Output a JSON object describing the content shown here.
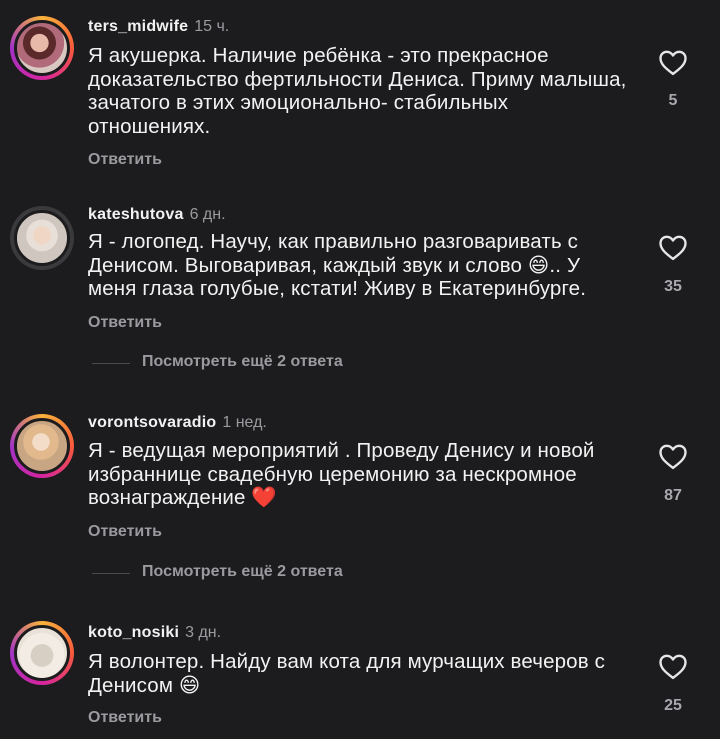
{
  "comments": [
    {
      "username": "ters_midwife",
      "time": "15 ч.",
      "text": "Я акушерка. Наличие ребёнка - это прекрасное доказательство фертильности Дениса.  Приму малыша, зачатого  в этих эмоционально- стабильных отношениях.",
      "reply_label": "Ответить",
      "likes": "5"
    },
    {
      "username": "kateshutova",
      "time": "6 дн.",
      "text": "Я - логопед. Научу, как правильно разговаривать с Денисом. Выговаривая, каждый звук и слово 😄.. У меня глаза голубые, кстати! Живу в Екатеринбурге.",
      "reply_label": "Ответить",
      "likes": "35",
      "more_replies": "Посмотреть ещё 2 ответа"
    },
    {
      "username": "vorontsovaradio",
      "time": "1 нед.",
      "text": "Я - ведущая мероприятий . Проведу Денису и новой избраннице свадебную церемонию за нескромное вознаграждение ❤️",
      "reply_label": "Ответить",
      "likes": "87",
      "more_replies": "Посмотреть ещё 2 ответа"
    },
    {
      "username": "koto_nosiki",
      "time": "3 дн.",
      "text": "Я волонтер. Найду вам кота для мурчащих вечеров с Денисом 😄",
      "reply_label": "Ответить",
      "likes": "25"
    }
  ],
  "icons": {
    "like": "heart-outline-icon"
  },
  "colors": {
    "background": "#1c1c1e",
    "text": "#f2f2f2",
    "secondary": "#9a9a9f",
    "story_ring": "#d6249f",
    "heart_emoji": "#e0245e"
  }
}
